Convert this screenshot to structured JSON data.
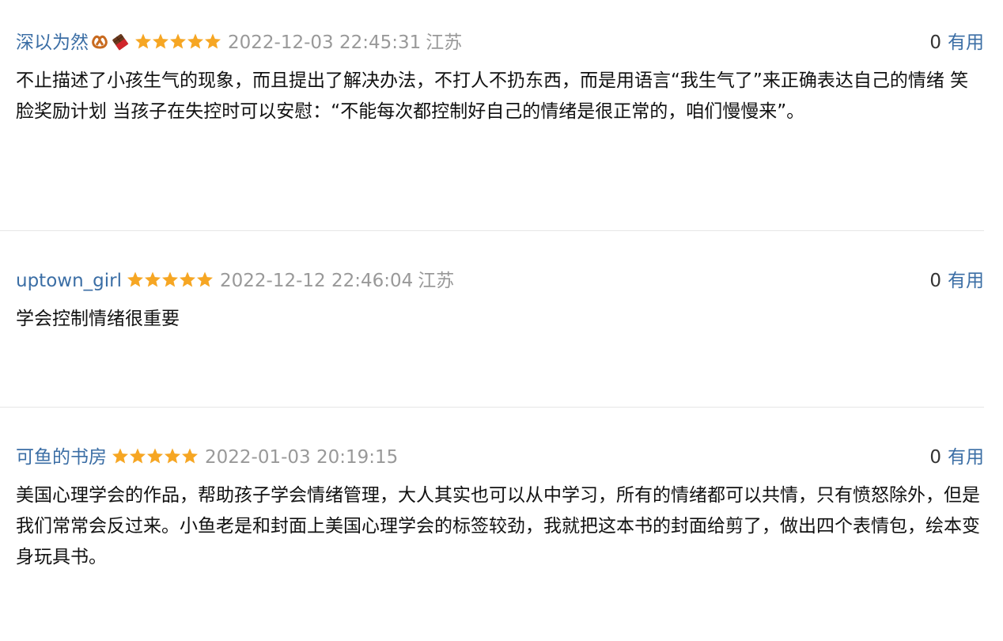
{
  "reviews": [
    {
      "author": "深以为然",
      "emoji_icons": [
        "pretzel-icon",
        "chocolate-icon"
      ],
      "rating": 5,
      "rating_max": 5,
      "time": "2022-12-03 22:45:31",
      "location": "江苏",
      "votes": "0",
      "vote_label": "有用",
      "content": "不止描述了小孩生气的现象，而且提出了解决办法，不打人不扔东西，而是用语言“我生气了”来正确表达自己的情绪 笑脸奖励计划 当孩子在失控时可以安慰：“不能每次都控制好自己的情绪是很正常的，咱们慢慢来”。"
    },
    {
      "author": "uptown_girl",
      "rating": 5,
      "rating_max": 5,
      "time": "2022-12-12 22:46:04",
      "location": "江苏",
      "votes": "0",
      "vote_label": "有用",
      "content": "学会控制情绪很重要"
    },
    {
      "author": "可鱼的书房",
      "rating": 5,
      "rating_max": 5,
      "time": "2022-01-03 20:19:15",
      "location": "",
      "votes": "0",
      "vote_label": "有用",
      "content": "美国心理学会的作品，帮助孩子学会情绪管理，大人其实也可以从中学习，所有的情绪都可以共情，只有愤怒除外，但是我们常常会反过来。小鱼老是和封面上美国心理学会的标签较劲，我就把这本书的封面给剪了，做出四个表情包，绘本变身玩具书。"
    }
  ],
  "colors": {
    "author": "#3b6ea5",
    "star": "#f6a623",
    "meta": "#999999",
    "divider": "#e6e6e6"
  }
}
